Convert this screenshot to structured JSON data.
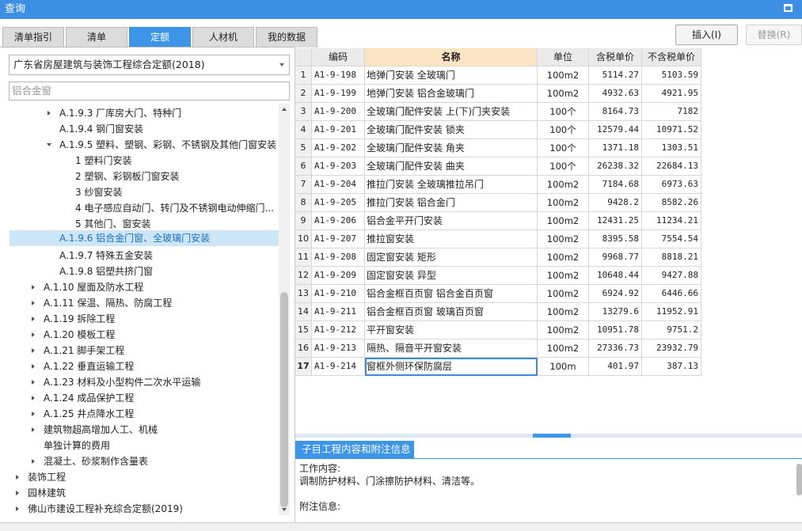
{
  "window": {
    "title": "查询"
  },
  "tabs": [
    "清单指引",
    "清单",
    "定额",
    "人材机",
    "我的数据"
  ],
  "toolbar": {
    "insert": "插入(I)",
    "replace": "替换(R)"
  },
  "left": {
    "quota_selected": "广东省房屋建筑与装饰工程综合定额(2018)",
    "search_value": "铝合金窗",
    "tree": [
      {
        "label": "A.1.9.3 厂库房大门、特种门"
      },
      {
        "label": "A.1.9.4 钢门窗安装"
      },
      {
        "label": "A.1.9.5 塑料、塑钢、彩钢、不锈钢及其他门窗安装"
      },
      {
        "label": "1 塑料门安装"
      },
      {
        "label": "2 塑钢、彩钢板门窗安装"
      },
      {
        "label": "3 纱窗安装"
      },
      {
        "label": "4 电子感应自动门、转门及不锈钢电动伸缩门..."
      },
      {
        "label": "5 其他门、窗安装"
      },
      {
        "label": "A.1.9.6 铝合金门窗、全玻璃门安装"
      },
      {
        "label": "A.1.9.7 特殊五金安装"
      },
      {
        "label": "A.1.9.8 铝塑共挤门窗"
      },
      {
        "label": "A.1.10 屋面及防水工程"
      },
      {
        "label": "A.1.11 保温、隔热、防腐工程"
      },
      {
        "label": "A.1.19 拆除工程"
      },
      {
        "label": "A.1.20 模板工程"
      },
      {
        "label": "A.1.21 脚手架工程"
      },
      {
        "label": "A.1.22 垂直运输工程"
      },
      {
        "label": "A.1.23 材料及小型构件二次水平运输"
      },
      {
        "label": "A.1.24 成品保护工程"
      },
      {
        "label": "A.1.25 井点降水工程"
      },
      {
        "label": "建筑物超高增加人工、机械"
      },
      {
        "label": "单独计算的费用"
      },
      {
        "label": "混凝土、砂浆制作含量表"
      },
      {
        "label": "装饰工程"
      },
      {
        "label": "园林建筑"
      },
      {
        "label": "佛山市建设工程补充综合定额(2019)"
      }
    ]
  },
  "grid": {
    "headers": {
      "code": "编码",
      "name": "名称",
      "unit": "单位",
      "tax_price": "含税单价",
      "notax_price": "不含税单价"
    },
    "rows": [
      {
        "n": "1",
        "code": "A1-9-198",
        "name": "地弹门安装 全玻璃门",
        "unit": "100m2",
        "tax": "5114.27",
        "notax": "5103.59"
      },
      {
        "n": "2",
        "code": "A1-9-199",
        "name": "地弹门安装 铝合金玻璃门",
        "unit": "100m2",
        "tax": "4932.63",
        "notax": "4921.95"
      },
      {
        "n": "3",
        "code": "A1-9-200",
        "name": "全玻璃门配件安装 上(下)门夹安装",
        "unit": "100个",
        "tax": "8164.73",
        "notax": "7182"
      },
      {
        "n": "4",
        "code": "A1-9-201",
        "name": "全玻璃门配件安装 锁夹",
        "unit": "100个",
        "tax": "12579.44",
        "notax": "10971.52"
      },
      {
        "n": "5",
        "code": "A1-9-202",
        "name": "全玻璃门配件安装 角夹",
        "unit": "100个",
        "tax": "1371.18",
        "notax": "1303.51"
      },
      {
        "n": "6",
        "code": "A1-9-203",
        "name": "全玻璃门配件安装 曲夹",
        "unit": "100个",
        "tax": "26238.32",
        "notax": "22684.13"
      },
      {
        "n": "7",
        "code": "A1-9-204",
        "name": "推拉门安装 全玻璃推拉吊门",
        "unit": "100m2",
        "tax": "7184.68",
        "notax": "6973.63"
      },
      {
        "n": "8",
        "code": "A1-9-205",
        "name": "推拉门安装 铝合金门",
        "unit": "100m2",
        "tax": "9428.2",
        "notax": "8582.26"
      },
      {
        "n": "9",
        "code": "A1-9-206",
        "name": "铝合金平开门安装",
        "unit": "100m2",
        "tax": "12431.25",
        "notax": "11234.21"
      },
      {
        "n": "10",
        "code": "A1-9-207",
        "name": "推拉窗安装",
        "unit": "100m2",
        "tax": "8395.58",
        "notax": "7554.54"
      },
      {
        "n": "11",
        "code": "A1-9-208",
        "name": "固定窗安装 矩形",
        "unit": "100m2",
        "tax": "9968.77",
        "notax": "8818.21"
      },
      {
        "n": "12",
        "code": "A1-9-209",
        "name": "固定窗安装 异型",
        "unit": "100m2",
        "tax": "10648.44",
        "notax": "9427.88"
      },
      {
        "n": "13",
        "code": "A1-9-210",
        "name": "铝合金框百页窗 铝合金百页窗",
        "unit": "100m2",
        "tax": "6924.92",
        "notax": "6446.66"
      },
      {
        "n": "14",
        "code": "A1-9-211",
        "name": "铝合金框百页窗 玻璃百页窗",
        "unit": "100m2",
        "tax": "13279.6",
        "notax": "11952.91"
      },
      {
        "n": "15",
        "code": "A1-9-212",
        "name": "平开窗安装",
        "unit": "100m2",
        "tax": "10951.78",
        "notax": "9751.2"
      },
      {
        "n": "16",
        "code": "A1-9-213",
        "name": "隔热、隔音平开窗安装",
        "unit": "100m2",
        "tax": "27336.73",
        "notax": "23932.79"
      },
      {
        "n": "17",
        "code": "A1-9-214",
        "name": "窗框外侧环保防腐层",
        "unit": "100m",
        "tax": "401.97",
        "notax": "387.13"
      }
    ]
  },
  "info": {
    "tab": "子目工程内容和附注信息",
    "work_label": "工作内容:",
    "work_text": "调制防护材料、门涂擦防护材料、清洁等。",
    "note_label": "附注信息:"
  },
  "colors": {
    "accent": "#3d95e8",
    "title_bar": "#3d8fe6",
    "name_header": "#fbe3c3",
    "selected_row": "#cde6f7"
  }
}
